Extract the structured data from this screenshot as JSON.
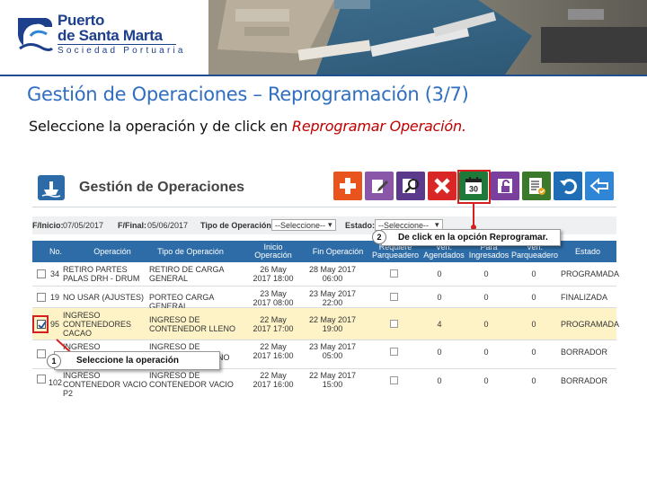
{
  "brand": {
    "line1": "Puerto",
    "line2": "de Santa Marta",
    "subtitle": "Sociedad Portuaria"
  },
  "slide": {
    "title": "Gestión de Operaciones – Reprogramación (3/7)",
    "instruction_prefix": "Seleccione la operación y de click en ",
    "instruction_action": "Reprogramar Operación."
  },
  "app": {
    "title": "Gestión de Operaciones",
    "toolbar": [
      {
        "icon": "plus-icon",
        "color": "#e8531e"
      },
      {
        "icon": "edit-icon",
        "color": "#8a56a8"
      },
      {
        "icon": "search-edit-icon",
        "color": "#5b3a8c"
      },
      {
        "icon": "close-icon",
        "color": "#d92626"
      },
      {
        "icon": "calendar-30-icon",
        "color": "#1f7a3a"
      },
      {
        "icon": "lock-open-icon",
        "color": "#7b3f9e"
      },
      {
        "icon": "checklist-icon",
        "color": "#3a7a2a"
      },
      {
        "icon": "undo-icon",
        "color": "#1f6db5"
      },
      {
        "icon": "back-arrow-icon",
        "color": "#2f86d6"
      }
    ],
    "calendar_day": "30",
    "filters": {
      "f_inicio_label": "F/Inicio:",
      "f_inicio_value": "07/05/2017",
      "f_final_label": "F/Final:",
      "f_final_value": "05/06/2017",
      "tipo_label": "Tipo de Operación:",
      "tipo_value": "--Seleccione--",
      "estado_label": "Estado:",
      "estado_value": "--Seleccione--"
    },
    "columns": [
      "No.",
      "Operación",
      "Tipo de Operación",
      "Inicio Operación",
      "Fin Operación",
      "Requiere Parqueadero",
      "Ven. Agendados",
      "Para Ingresados",
      "Ven. Parqueadero",
      "Estado"
    ],
    "rows": [
      {
        "no": "34",
        "operacion": "RETIRO PARTES PALAS DRH - DRUM",
        "tipo": "RETIRO DE CARGA GENERAL",
        "inicio": "26 May 2017 18:00",
        "fin": "28 May 2017 06:00",
        "agendados": "0",
        "ingresados": "0",
        "parqueadero": "0",
        "estado": "PROGRAMADA",
        "checked": false
      },
      {
        "no": "19",
        "operacion": "NO USAR (AJUSTES)",
        "tipo": "PORTEO CARGA GENERAL",
        "inicio": "23 May 2017 08:00",
        "fin": "23 May 2017 22:00",
        "agendados": "0",
        "ingresados": "0",
        "parqueadero": "0",
        "estado": "FINALIZADA",
        "checked": false
      },
      {
        "no": "95",
        "operacion": "INGRESO CONTENEDORES CACAO",
        "tipo": "INGRESO DE CONTENEDOR LLENO",
        "inicio": "22 May 2017 17:00",
        "fin": "22 May 2017 19:00",
        "agendados": "4",
        "ingresados": "0",
        "parqueadero": "0",
        "estado": "PROGRAMADA",
        "checked": true
      },
      {
        "no": "",
        "operacion": "INGRESO",
        "tipo": "INGRESO DE",
        "inicio": "22 May 2017 16:00",
        "fin": "23 May 2017 05:00",
        "agendados": "0",
        "ingresados": "0",
        "parqueadero": "0",
        "estado": "BORRADOR",
        "checked": false
      },
      {
        "no": "102",
        "operacion": "INGRESO CONTENEDOR VACIO P2",
        "tipo": "INGRESO DE CONTENEDOR VACIO",
        "inicio": "22 May 2017 16:00",
        "fin": "22 May 2017 15:00",
        "agendados": "0",
        "ingresados": "0",
        "parqueadero": "0",
        "estado": "BORRADOR",
        "checked": false
      }
    ],
    "row4_tipo_tail": "LLENO"
  },
  "callouts": {
    "step1_number": "1",
    "step1_text": "Seleccione la operación",
    "step2_number": "2",
    "step2_text": "De click en la opción Reprogramar."
  },
  "colors": {
    "title_blue": "#2f6ec0",
    "table_header": "#2d6ca6",
    "highlight_row": "#fdf3c7",
    "red_annotation": "#d62020"
  }
}
